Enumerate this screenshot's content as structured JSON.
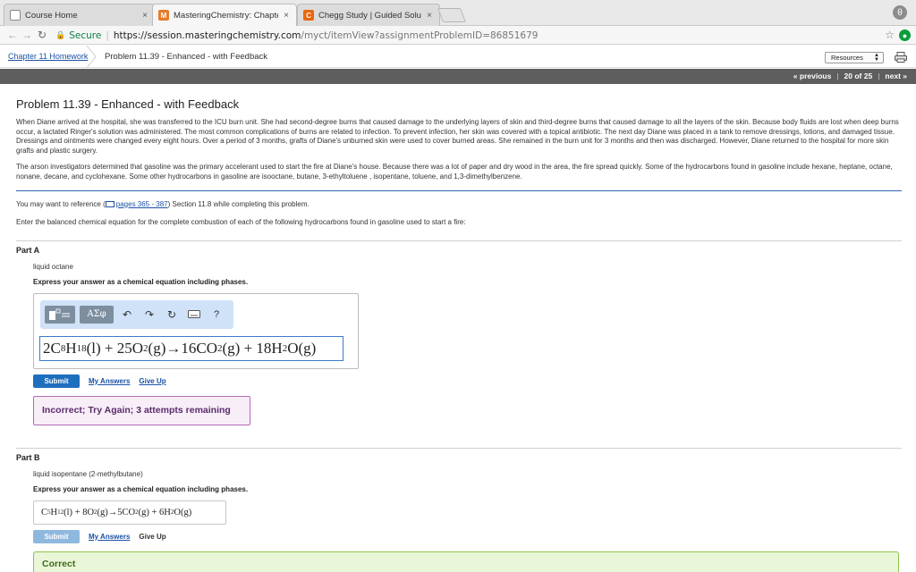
{
  "browser": {
    "tabs": [
      {
        "label": "Course Home",
        "icon": "page-icon"
      },
      {
        "label": "MasteringChemistry: Chapter",
        "icon": "mastering-icon"
      },
      {
        "label": "Chegg Study | Guided Solution",
        "icon": "chegg-icon"
      }
    ],
    "close_glyph": "×",
    "profile_glyph": "θ",
    "address": {
      "secure_label": "Secure",
      "url_host": "https://session.masteringchemistry.com",
      "url_path": "/myct/itemView?assignmentProblemID=86851679"
    }
  },
  "header": {
    "breadcrumb": "Chapter 11 Homework",
    "title": "Problem 11.39 - Enhanced - with Feedback",
    "resources_label": "Resources",
    "pager": {
      "prev": "« previous",
      "position": "20 of 25",
      "next": "next »",
      "divider": "|"
    }
  },
  "problem": {
    "title": "Problem 11.39 - Enhanced - with Feedback",
    "para1": "When Diane arrived at the hospital, she was transferred to the ICU burn unit. She had second-degree burns that caused damage to the underlying layers of skin and third-degree burns that caused damage to all the layers of the skin. Because body fluids are lost when deep burns occur, a lactated Ringer's solution was administered. The most common complications of burns are related to infection. To prevent infection, her skin was covered with a topical antibiotic. The next day Diane was placed in a tank to remove dressings, lotions, and damaged tissue. Dressings and ointments were changed every eight hours. Over a period of 3 months, grafts of Diane's unburned skin were used to cover burned areas. She remained in the burn unit for 3 months and then was discharged. However, Diane returned to the hospital for more skin grafts and plastic surgery.",
    "para2": "The arson investigators determined that gasoline was the primary accelerant used to start the fire at Diane's house. Because there was a lot of paper and dry wood in the area, the fire spread quickly. Some of the hydrocarbons found in gasoline include hexane, heptane, octane, nonane, decane, and cyclohexane. Some other hydrocarbons in gasoline are isooctane, butane, 3-ethyltoluene , isopentane, toluene, and 1,3-dimethylbenzene.",
    "ref_prefix": "You may want to reference (",
    "ref_link": "pages 365 - 387",
    "ref_suffix": ") Section 11.8 while completing this problem.",
    "prompt": "Enter the balanced chemical equation for the complete combustion of each of the following hydrocarbons found in gasoline used to start a fire:"
  },
  "part_a": {
    "heading": "Part A",
    "substance": "liquid octane",
    "instruction": "Express your answer as a chemical equation including phases.",
    "toolbar": {
      "greek_label": "ΑΣφ",
      "help_label": "?"
    },
    "equation": {
      "c1": "2C",
      "s1": "8",
      "t1": "H",
      "s2": "18",
      "t2": "(l) + 25O",
      "s3": "2",
      "t3": "(g)→16CO",
      "s4": "2",
      "t4": "(g) + 18H",
      "s5": "2",
      "t5": "O(g)"
    },
    "submit_label": "Submit",
    "my_answers_label": "My Answers",
    "give_up_label": "Give Up",
    "feedback": "Incorrect; Try Again; 3 attempts remaining"
  },
  "part_b": {
    "heading": "Part B",
    "substance": "liquid isopentane (2-methylbutane)",
    "instruction": "Express your answer as a chemical equation including phases.",
    "equation": {
      "c1": "C",
      "s1": "5",
      "t1": "H",
      "s2": "12",
      "t2": "(l) + 8O",
      "s3": "2",
      "t3": "(g)→5CO",
      "s4": "2",
      "t4": "(g) + 6H",
      "s5": "2",
      "t5": "O(g)"
    },
    "submit_label": "Submit",
    "my_answers_label": "My Answers",
    "give_up_label": "Give Up",
    "feedback": "Correct"
  },
  "colors": {
    "accent": "#1f6fbf",
    "pager_bg": "#5e5e5e",
    "incorrect_border": "#b56ab8",
    "correct_border": "#8bc34a"
  }
}
